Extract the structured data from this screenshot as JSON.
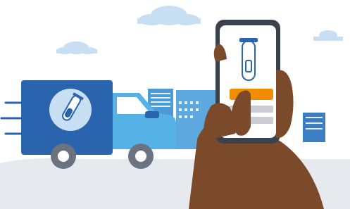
{
  "scene": {
    "alt_icons": {
      "truck_emblem": "test-tube-icon",
      "phone_screen": "test-tube-icon"
    },
    "phone": {
      "button_label": "",
      "button_color": "#F28C00"
    },
    "colors": {
      "truck_dark": "#2A63AE",
      "truck_light": "#56B1E6",
      "sky_cloud": "#C8DEF3",
      "ground": "#E6E9EE",
      "skin": "#7A4A2A",
      "buildings": "#4C9AD8"
    }
  }
}
